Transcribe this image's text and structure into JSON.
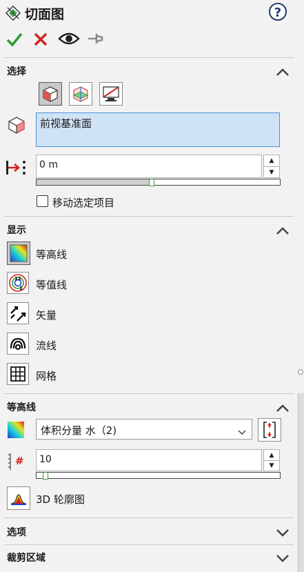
{
  "panel": {
    "title": "切面图"
  },
  "sections": {
    "selection": "选择",
    "display": "显示",
    "contours": "等高线",
    "options": "选项",
    "clip_region": "裁剪区域"
  },
  "selection": {
    "plane_value": "前视基准面",
    "offset_value": "0 m",
    "offset_slider_fraction": 0.47,
    "move_checkbox_label": "移动选定项目",
    "move_checkbox_checked": false
  },
  "display_items": [
    "等高线",
    "等值线",
    "矢量",
    "流线",
    "网格"
  ],
  "contours": {
    "parameter": "体积分量 水（2)",
    "levels_value": "10",
    "levels_slider_fraction": 0.02,
    "profile_3d_label": "3D 轮廓图"
  },
  "colors": {
    "accent": "#4a90d9",
    "ok": "#2e9a2e",
    "cancel": "#d22020"
  },
  "icons": [
    "contour-icon",
    "isoline-icon",
    "vector-icon",
    "streamline-icon",
    "mesh-icon"
  ]
}
